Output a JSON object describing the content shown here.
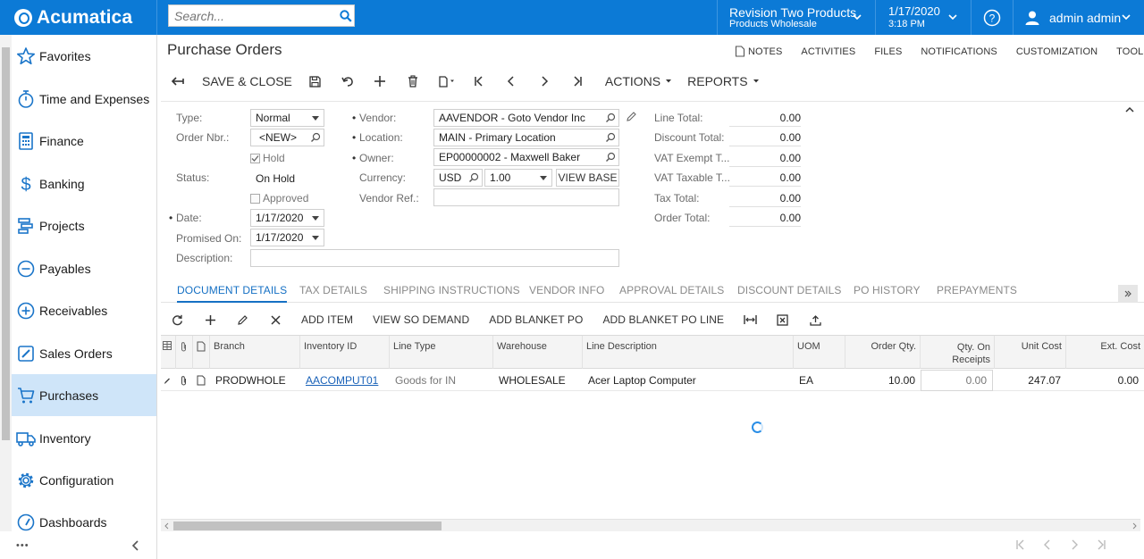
{
  "app": {
    "name": "Acumatica"
  },
  "search": {
    "placeholder": "Search..."
  },
  "branch": {
    "company": "Revision Two Products",
    "branch": "Products Wholesale"
  },
  "business_date": {
    "date": "1/17/2020",
    "time": "3:18 PM"
  },
  "user": {
    "name": "admin admin"
  },
  "sidebar": {
    "items": [
      {
        "label": "Favorites",
        "icon": "star-icon"
      },
      {
        "label": "Time and Expenses",
        "icon": "stopwatch-icon"
      },
      {
        "label": "Finance",
        "icon": "calculator-icon"
      },
      {
        "label": "Banking",
        "icon": "dollar-icon"
      },
      {
        "label": "Projects",
        "icon": "projects-icon"
      },
      {
        "label": "Payables",
        "icon": "minus-circle-icon"
      },
      {
        "label": "Receivables",
        "icon": "plus-circle-icon"
      },
      {
        "label": "Sales Orders",
        "icon": "pencil-square-icon"
      },
      {
        "label": "Purchases",
        "icon": "cart-icon",
        "active": true
      },
      {
        "label": "Inventory",
        "icon": "truck-icon"
      },
      {
        "label": "Configuration",
        "icon": "gear-icon"
      },
      {
        "label": "Dashboards",
        "icon": "gauge-icon"
      }
    ],
    "more": "•••"
  },
  "page": {
    "title": "Purchase Orders"
  },
  "header_links": [
    "NOTES",
    "ACTIVITIES",
    "FILES",
    "NOTIFICATIONS",
    "CUSTOMIZATION",
    "TOOLS"
  ],
  "toolbar": {
    "save_close": "SAVE & CLOSE",
    "actions": "ACTIONS",
    "reports": "REPORTS"
  },
  "form": {
    "type_label": "Type:",
    "type_value": "Normal",
    "order_nbr_label": "Order Nbr.:",
    "order_nbr_value": "<NEW>",
    "hold_label": "Hold",
    "status_label": "Status:",
    "status_value": "On Hold",
    "approved_label": "Approved",
    "date_label": "Date:",
    "date_value": "1/17/2020",
    "promised_label": "Promised On:",
    "promised_value": "1/17/2020",
    "description_label": "Description:",
    "description_value": "",
    "vendor_label": "Vendor:",
    "vendor_value": "AAVENDOR - Goto Vendor Inc",
    "location_label": "Location:",
    "location_value": "MAIN - Primary Location",
    "owner_label": "Owner:",
    "owner_value": "EP00000002 - Maxwell Baker",
    "currency_label": "Currency:",
    "currency_value": "USD",
    "rate_value": "1.00",
    "view_base": "VIEW BASE",
    "vendor_ref_label": "Vendor Ref.:",
    "vendor_ref_value": ""
  },
  "totals": [
    {
      "label": "Line Total:",
      "value": "0.00"
    },
    {
      "label": "Discount Total:",
      "value": "0.00"
    },
    {
      "label": "VAT Exempt T...",
      "value": "0.00"
    },
    {
      "label": "VAT Taxable T...",
      "value": "0.00"
    },
    {
      "label": "Tax Total:",
      "value": "0.00"
    },
    {
      "label": "Order Total:",
      "value": "0.00"
    }
  ],
  "tabs": [
    "DOCUMENT DETAILS",
    "TAX DETAILS",
    "SHIPPING INSTRUCTIONS",
    "VENDOR INFO",
    "APPROVAL DETAILS",
    "DISCOUNT DETAILS",
    "PO HISTORY",
    "PREPAYMENTS"
  ],
  "grid_toolbar": [
    "ADD ITEM",
    "VIEW SO DEMAND",
    "ADD BLANKET PO",
    "ADD BLANKET PO LINE"
  ],
  "grid": {
    "columns": [
      "Branch",
      "Inventory ID",
      "Line Type",
      "Warehouse",
      "Line Description",
      "UOM",
      "Order Qty.",
      "Qty. On Receipts",
      "Unit Cost",
      "Ext. Cost"
    ],
    "rows": [
      {
        "branch": "PRODWHOLE",
        "inventory_id": "AACOMPUT01",
        "line_type": "Goods for IN",
        "warehouse": "WHOLESALE",
        "description": "Acer Laptop Computer",
        "uom": "EA",
        "order_qty": "10.00",
        "qty_receipts": "0.00",
        "unit_cost": "247.07",
        "ext_cost": "0.00"
      }
    ]
  },
  "colors": {
    "brand": "#0c7ad6",
    "active_nav": "#cfe5f9",
    "link": "#1570c4"
  }
}
